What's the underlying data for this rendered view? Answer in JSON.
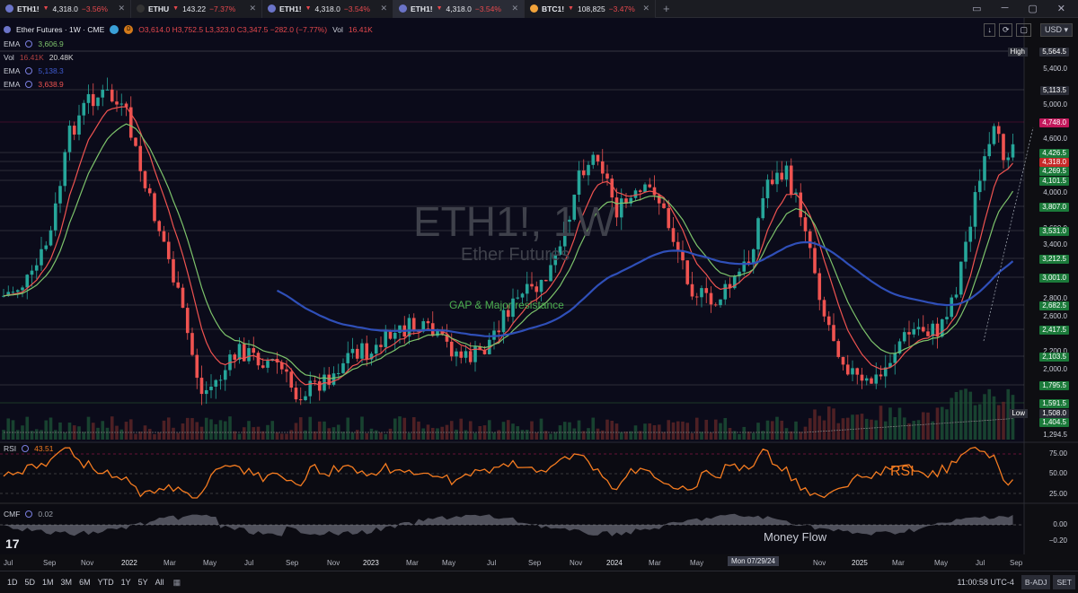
{
  "tabs": [
    {
      "symbol": "ETH1!",
      "price": "4,318.0",
      "change": "−3.56%",
      "icon": "eth"
    },
    {
      "symbol": "ETHU",
      "price": "143.22",
      "change": "−7.37%",
      "icon": "etf"
    },
    {
      "symbol": "ETH1!",
      "price": "4,318.0",
      "change": "−3.54%",
      "icon": "eth"
    },
    {
      "symbol": "ETH1!",
      "price": "4,318.0",
      "change": "−3.54%",
      "icon": "eth",
      "active": true
    },
    {
      "symbol": "BTC1!",
      "price": "108,825",
      "change": "−3.47%",
      "icon": "btc"
    }
  ],
  "legend": {
    "title": "Ether Futures · 1W · CME",
    "ohlc": "O3,614.0  H3,752.5  L3,323.0  C3,347.5  −282.0 (−7.77%)",
    "vol_label": "Vol",
    "vol_value": "16.41K",
    "ema1_label": "EMA",
    "ema1_value": "3,606.9",
    "vol2_label": "Vol",
    "vol2_a": "16.41K",
    "vol2_b": "20.48K",
    "ema2_label": "EMA",
    "ema2_value": "5,138.3",
    "ema3_label": "EMA",
    "ema3_value": "3,638.9",
    "rsi_label": "RSI",
    "rsi_value": "43.51",
    "cmf_label": "CMF",
    "cmf_value": "0.02"
  },
  "currency": "USD",
  "watermark": {
    "symbol": "ETH1!, 1W",
    "name": "Ether Futures"
  },
  "annotations": {
    "gap": "GAP & Major resistance",
    "rsi": "RSI",
    "money_flow": "Money Flow"
  },
  "price_axis": {
    "labels": [
      "5,400.0",
      "5,000.0",
      "4,600.0",
      "4,000.0",
      "3,600.0",
      "3,400.0",
      "2,800.0",
      "2,600.0",
      "2,200.0",
      "2,000.0",
      "1,294.5"
    ],
    "tags": [
      {
        "label": "High",
        "value": "5,564.5",
        "color": "#2a2c36"
      },
      {
        "value": "5,113.5",
        "color": "#2a2c36"
      },
      {
        "value": "4,748.0",
        "color": "#c2185b"
      },
      {
        "value": "4,426.5",
        "color": "#1b7a3a"
      },
      {
        "value": "4,318.0",
        "color": "#c62828"
      },
      {
        "value": "4,269.5",
        "color": "#1b7a3a"
      },
      {
        "value": "4,101.5",
        "color": "#1b7a3a"
      },
      {
        "value": "3,807.0",
        "color": "#1b7a3a"
      },
      {
        "value": "3,531.0",
        "color": "#1b7a3a"
      },
      {
        "value": "3,212.5",
        "color": "#1b7a3a"
      },
      {
        "value": "3,001.0",
        "color": "#1b7a3a"
      },
      {
        "value": "2,682.5",
        "color": "#1b7a3a"
      },
      {
        "value": "2,417.5",
        "color": "#1b7a3a"
      },
      {
        "value": "2,103.5",
        "color": "#1b7a3a"
      },
      {
        "value": "1,795.5",
        "color": "#1b7a3a"
      },
      {
        "value": "1,591.5",
        "color": "#1b7a3a"
      },
      {
        "label": "Low",
        "value": "1,508.0",
        "color": "#2a2c36"
      },
      {
        "value": "1,404.5",
        "color": "#1b7a3a"
      }
    ]
  },
  "rsi_axis": [
    "75.00",
    "50.00",
    "25.00"
  ],
  "cmf_axis": [
    "0.00",
    "−0.20"
  ],
  "time_axis": [
    "Jul",
    "Sep",
    "Nov",
    "2022",
    "Mar",
    "May",
    "Jul",
    "Sep",
    "Nov",
    "2023",
    "Mar",
    "May",
    "Jul",
    "Sep",
    "Nov",
    "2024",
    "Mar",
    "May",
    "Nov",
    "2025",
    "Mar",
    "May",
    "Jul",
    "Sep"
  ],
  "crosshair_date": "Mon 07/29/24",
  "ranges": [
    "1D",
    "5D",
    "1M",
    "3M",
    "6M",
    "YTD",
    "1Y",
    "5Y",
    "All"
  ],
  "clock": "11:00:58 UTC-4",
  "bottom_buttons": [
    "B-ADJ",
    "SET"
  ],
  "colors": {
    "up": "#26a69a",
    "down": "#ef5350",
    "ema_fast": "#ef5350",
    "ema_mid": "#7dc36b",
    "ema_slow": "#2f4fb8",
    "rsi": "#f47b20"
  }
}
